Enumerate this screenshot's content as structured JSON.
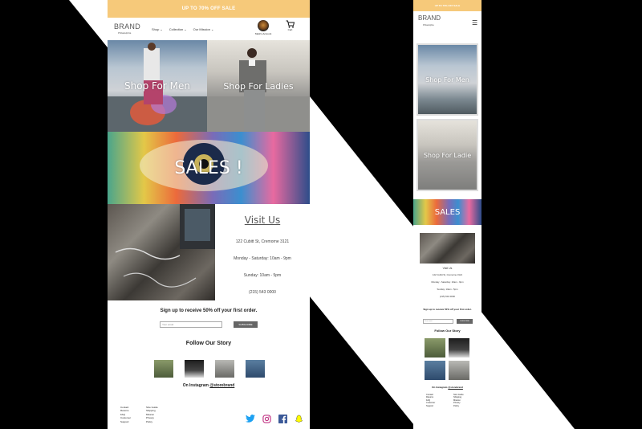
{
  "desktop": {
    "promo": "UP TO 70% OFF SALE",
    "brand": "BRAND",
    "brand_sub": "Philadelphia",
    "menu": [
      "Shop",
      "Collection",
      "Our Mission"
    ],
    "chevron": "⌄",
    "account_label": "Mark's Account",
    "cart_label": "Cart",
    "tiles": {
      "men": "Shop For Men",
      "ladies": "Shop For Ladies",
      "sales": "SALES !"
    },
    "visit": {
      "title": "Visit Us",
      "address": "122 Cubitt St, Cremorne 3121",
      "hours_week": "Monday - Saturday: 10am - 9pm",
      "hours_sun": "Sunday: 10am - 5pm",
      "phone": "(215) 543 0000"
    },
    "signup": {
      "heading": "Sign up to receive 50% off your first order.",
      "placeholder": "Your email",
      "button": "SUBSCRIBE"
    },
    "follow": "Follow Our Story",
    "instagram_prefix": "On Instagram ",
    "instagram_handle": "@storebrand",
    "footer_col1": [
      "Contact",
      "Returns",
      "FAQ",
      "Customer Support"
    ],
    "footer_col2": [
      "Size Guide",
      "Shipping",
      "Mission",
      "Privacy Policy"
    ],
    "social": [
      "twitter-icon",
      "instagram-icon",
      "facebook-icon",
      "snapchat-icon"
    ]
  },
  "mobile": {
    "promo": "UP TO 70% OFF SALE",
    "brand": "BRAND",
    "brand_sub": "Philadelphia",
    "hamburger": "☰",
    "men": "Shop For Men",
    "ladies": "Shop For Ladie",
    "sales": "SALES",
    "visit_title": "Visit Us",
    "address": "122 Cubitt St, Cremorne 3121",
    "hours_week": "Monday - Saturday: 10am - 9pm",
    "hours_sun": "Sunday: 10am - 5pm",
    "phone": "(215) 543 0000",
    "signup": "Sign up to receive 50% off your first order.",
    "placeholder": "Your email",
    "button": "SUBSCRIBE",
    "follow": "Follow Our Story",
    "instagram_prefix": "On Instagram ",
    "instagram_handle": "@storebrand",
    "footer_col1": [
      "Contact",
      "Returns",
      "FAQ",
      "Customer Support"
    ],
    "footer_col2": [
      "Size Guide",
      "Shipping",
      "Mission",
      "Privacy Policy"
    ]
  },
  "colors": {
    "promo": "#f6c97a",
    "button": "#666666",
    "backdrop": "#000000"
  }
}
